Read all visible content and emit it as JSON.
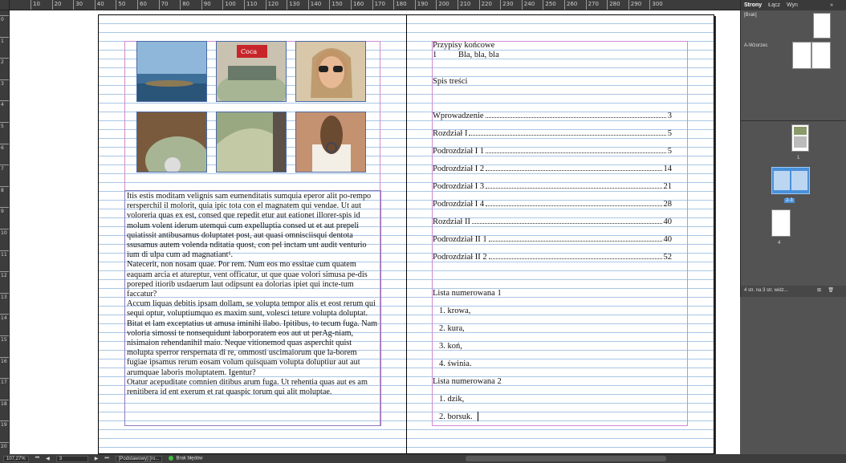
{
  "ruler": {
    "h_labels": [
      "10",
      "20",
      "30",
      "40",
      "50",
      "60",
      "70",
      "80",
      "90",
      "100",
      "110",
      "120",
      "130",
      "140",
      "150",
      "160",
      "170",
      "180",
      "190",
      "200",
      "210",
      "220",
      "230",
      "240",
      "250",
      "260",
      "270",
      "280",
      "290",
      "300"
    ],
    "v_labels": [
      "0",
      "1",
      "2",
      "3",
      "4",
      "5",
      "6",
      "7",
      "8",
      "9",
      "10",
      "11",
      "12",
      "13",
      "14",
      "15",
      "16",
      "17",
      "18",
      "19",
      "20"
    ]
  },
  "left_page": {
    "paragraphs": [
      "Itis estis moditam velignis sam eumenditatis sumquia eperor alit po-rempo rersperchil il molorit, quia ipic tota con el magnatem qui vendae. Ut aut voloreria quas ex est, consed que repedit etur aut eationet illorer-spis id molum volent iderum utemqui cum expelluptia consed ut et aut prepeli quiatissit antibusamus doluptatet post, aut quasi omnisciisqui dentota ssusamus autem volenda nditatia quost, con pel inctam unt audit venturio ium di ulpa cum ad magnatiant¹.",
      "Natecerit, non nosam quae. Por rem. Num eos mo essitae cum quatem eaquam arcia et atureptur, vent officatur, ut que quae volori simusa pe-dis poreped itiorib usdaerum laut odipsunt ea dolorias ipiet qui incte-tum faccatur?",
      "Accum liquas debitis ipsam dollam, se volupta tempor alis et eost rerum qui sequi optur, voluptiumquo es maxim sunt, volesci teture volupta doluptat.",
      "Bitat et lam exceptatius ut amusa iminihi llabo. Ipitibus, to tecum fuga. Nam voloria simossi te nonsequidunt laborporatem eos aut ut perAg-niam, nisimaion rehendanihil maio. Neque vitionemod quas asperchit quist molupta sperror rerspernata di re, ommosti uscimaiorum que la-borem fugiae ipsamus rerum eosam volum quisquam volupta doluptiur aut aut arumquae laboris moluptatem. Igentur?",
      "Otatur acepuditate comnien ditibus arum fuga. Ut rehentia quas aut es am renitibera id ent exerum et rat quaspic torum qui alit moluptae."
    ]
  },
  "right_page": {
    "endnotes_heading": "Przypisy końcowe",
    "endnote_num": "1",
    "endnote_text": "Bla, bla, bla",
    "toc_heading": "Spis treści",
    "toc": [
      {
        "label": "Wprowadzenie",
        "page": "3"
      },
      {
        "label": "Rozdział I",
        "page": "5"
      },
      {
        "label": "Podrozdział I 1",
        "page": "5"
      },
      {
        "label": "Podrozdział I 2",
        "page": "14"
      },
      {
        "label": "Podrozdział I 3",
        "page": "21"
      },
      {
        "label": "Podrozdział I 4",
        "page": "28"
      },
      {
        "label": "Rozdział II",
        "page": "40"
      },
      {
        "label": "Podrozdział II 1",
        "page": "40"
      },
      {
        "label": "Podrozdział II 2",
        "page": "52"
      }
    ],
    "list1_heading": "Lista numerowana 1",
    "list1": [
      "1.  krowa,",
      "2.  kura,",
      "3.  koń,",
      "4.  świnia."
    ],
    "list2_heading": "Lista numerowana 2",
    "list2": [
      "1.  dzik,",
      "2.  borsuk."
    ]
  },
  "panel": {
    "tabs": [
      "Strony",
      "Łącz",
      "Wyn"
    ],
    "more": "»",
    "masters": [
      "[Brak]",
      "A-Wzorzec"
    ],
    "page_labels": [
      "1",
      "2-3",
      "4"
    ],
    "footer": "4 str. na 3 str. widz..."
  },
  "status": {
    "zoom": "107,27%",
    "page": "3",
    "style": "[Podstawowy] [ro...",
    "preflight": "Brak błędów"
  },
  "colors": {
    "accent": "#4a90d9",
    "margin": "#d08ad0",
    "baseline": "#a9c6e6",
    "preflight_ok": "#3fbf3f"
  }
}
